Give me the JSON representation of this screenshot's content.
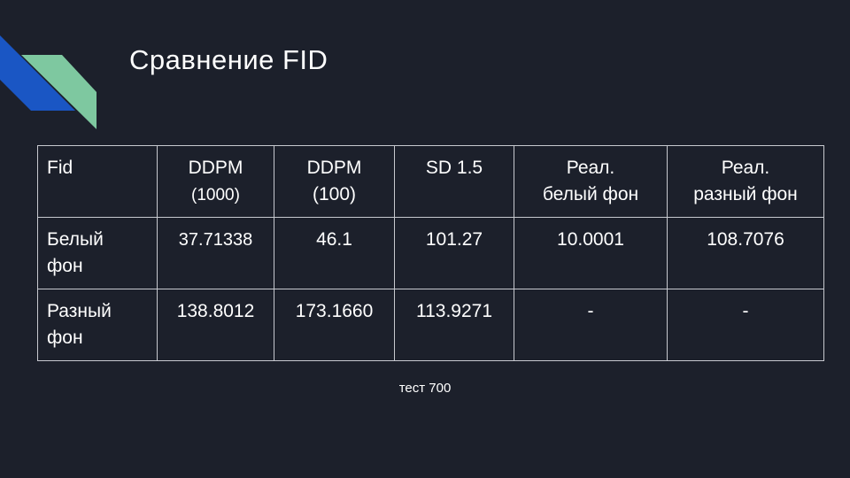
{
  "slide": {
    "title": "Сравнение FID",
    "caption": "тест 700"
  },
  "colors": {
    "background": "#1c202b",
    "accent_blue": "#1a56c4",
    "accent_green": "#7ec8a0",
    "text": "#ffffff",
    "border": "#c7c9cf"
  },
  "table": {
    "header": {
      "c0": "Fid",
      "c1_line1": "DDPM",
      "c1_line2": "(1000)",
      "c2_line1": "DDPM",
      "c2_line2": "(100)",
      "c3": "SD 1.5",
      "c4_line1": "Реал.",
      "c4_line2": "белый фон",
      "c5_line1": "Реал.",
      "c5_line2": "разный фон"
    },
    "rows": [
      {
        "label_line1": "Белый",
        "label_line2": "фон",
        "c1": "37.71338",
        "c2": "46.1",
        "c3": "101.27",
        "c4": "10.0001",
        "c5": "108.7076"
      },
      {
        "label_line1": "Разный",
        "label_line2": "фон",
        "c1": "138.8012",
        "c2": "173.1660",
        "c3": "113.9271",
        "c4": "-",
        "c5": "-"
      }
    ]
  }
}
